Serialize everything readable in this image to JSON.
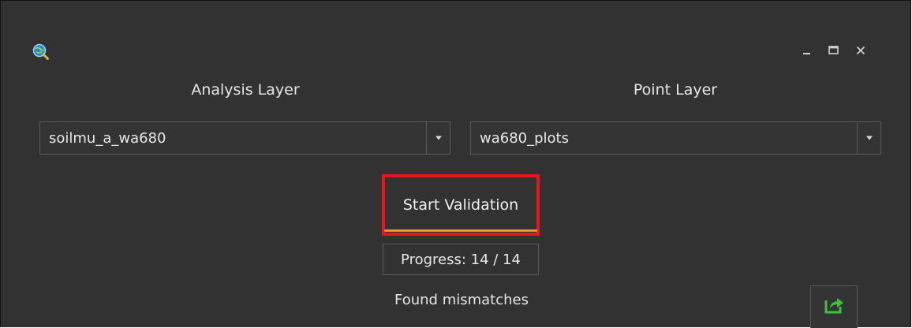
{
  "window": {
    "app_icon": "magnifier-globe-icon",
    "controls": {
      "minimize": "minimize-icon",
      "maximize": "maximize-icon",
      "close": "close-icon"
    }
  },
  "analysis": {
    "label": "Analysis Layer",
    "selected": "soilmu_a_wa680"
  },
  "point": {
    "label": "Point Layer",
    "selected": "wa680_plots"
  },
  "actions": {
    "start_label": "Start Validation",
    "export_icon": "export-icon"
  },
  "progress": {
    "text": "Progress: 14 / 14"
  },
  "results": {
    "label": "Found mismatches"
  },
  "colors": {
    "background": "#323232",
    "highlight_border": "#e8151b",
    "accent_underline": "#e39a2c",
    "export_green": "#3cc23c"
  }
}
